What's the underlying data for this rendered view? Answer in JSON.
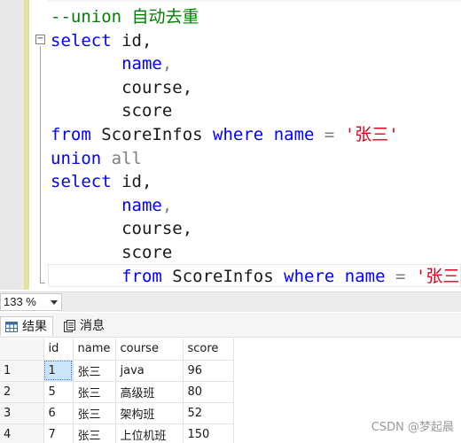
{
  "editor": {
    "lines": [
      [
        {
          "t": "--union 自动去重",
          "c": "cm"
        }
      ],
      [
        {
          "t": "select",
          "c": "kw"
        },
        {
          "t": " id,",
          "c": "tx"
        }
      ],
      [
        {
          "t": "       name",
          "c": "kw"
        },
        {
          "t": ",",
          "c": "gr"
        }
      ],
      [
        {
          "t": "       course,",
          "c": "tx"
        }
      ],
      [
        {
          "t": "       score",
          "c": "tx"
        }
      ],
      [
        {
          "t": "from",
          "c": "kw"
        },
        {
          "t": " ScoreInfos ",
          "c": "tx"
        },
        {
          "t": "where",
          "c": "kw"
        },
        {
          "t": " ",
          "c": "tx"
        },
        {
          "t": "name",
          "c": "kw"
        },
        {
          "t": " = ",
          "c": "gr"
        },
        {
          "t": "'张三'",
          "c": "st"
        }
      ],
      [
        {
          "t": "union",
          "c": "kw"
        },
        {
          "t": " all",
          "c": "gr"
        }
      ],
      [
        {
          "t": "select",
          "c": "kw"
        },
        {
          "t": " id,",
          "c": "tx"
        }
      ],
      [
        {
          "t": "       name",
          "c": "kw"
        },
        {
          "t": ",",
          "c": "gr"
        }
      ],
      [
        {
          "t": "       course,",
          "c": "tx"
        }
      ],
      [
        {
          "t": "       score",
          "c": "tx"
        }
      ],
      [
        {
          "t": "       ",
          "c": "tx"
        },
        {
          "t": "from",
          "c": "kw"
        },
        {
          "t": " ScoreInfos ",
          "c": "tx"
        },
        {
          "t": "where",
          "c": "kw"
        },
        {
          "t": " ",
          "c": "tx"
        },
        {
          "t": "name",
          "c": "kw"
        },
        {
          "t": " = ",
          "c": "gr"
        },
        {
          "t": "'张三'",
          "c": "st"
        }
      ]
    ]
  },
  "status": {
    "zoom": "133 %"
  },
  "tabs": [
    {
      "label": "结果",
      "icon": "grid-icon",
      "active": true
    },
    {
      "label": "消息",
      "icon": "message-icon",
      "active": false
    }
  ],
  "results": {
    "columns": [
      "id",
      "name",
      "course",
      "score"
    ],
    "rows": [
      {
        "num": "1",
        "cells": [
          "1",
          "张三",
          "java",
          "96"
        ]
      },
      {
        "num": "2",
        "cells": [
          "5",
          "张三",
          "高级班",
          "80"
        ]
      },
      {
        "num": "3",
        "cells": [
          "6",
          "张三",
          "架构班",
          "52"
        ]
      },
      {
        "num": "4",
        "cells": [
          "7",
          "张三",
          "上位机班",
          "150"
        ]
      }
    ]
  },
  "watermark": "CSDN @梦起晨",
  "colors": {
    "keyword": "#0000ff",
    "string": "#e0001a",
    "comment": "#008000",
    "selected_cell": "#cce4f7"
  }
}
